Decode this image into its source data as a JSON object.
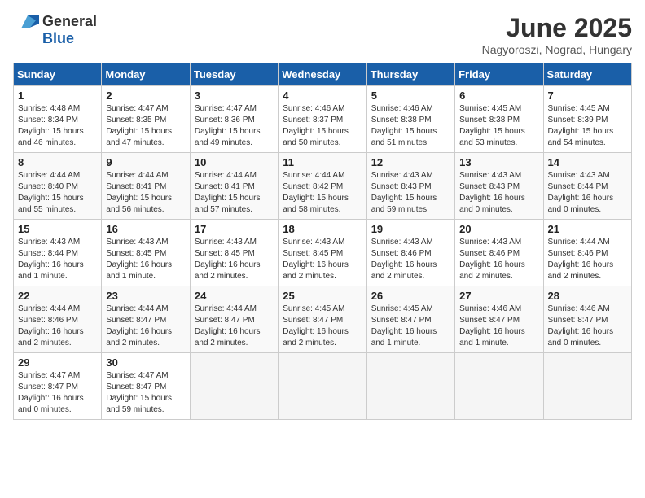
{
  "logo": {
    "general": "General",
    "blue": "Blue"
  },
  "title": "June 2025",
  "location": "Nagyoroszi, Nograd, Hungary",
  "weekdays": [
    "Sunday",
    "Monday",
    "Tuesday",
    "Wednesday",
    "Thursday",
    "Friday",
    "Saturday"
  ],
  "weeks": [
    [
      {
        "day": "1",
        "info": "Sunrise: 4:48 AM\nSunset: 8:34 PM\nDaylight: 15 hours\nand 46 minutes."
      },
      {
        "day": "2",
        "info": "Sunrise: 4:47 AM\nSunset: 8:35 PM\nDaylight: 15 hours\nand 47 minutes."
      },
      {
        "day": "3",
        "info": "Sunrise: 4:47 AM\nSunset: 8:36 PM\nDaylight: 15 hours\nand 49 minutes."
      },
      {
        "day": "4",
        "info": "Sunrise: 4:46 AM\nSunset: 8:37 PM\nDaylight: 15 hours\nand 50 minutes."
      },
      {
        "day": "5",
        "info": "Sunrise: 4:46 AM\nSunset: 8:38 PM\nDaylight: 15 hours\nand 51 minutes."
      },
      {
        "day": "6",
        "info": "Sunrise: 4:45 AM\nSunset: 8:38 PM\nDaylight: 15 hours\nand 53 minutes."
      },
      {
        "day": "7",
        "info": "Sunrise: 4:45 AM\nSunset: 8:39 PM\nDaylight: 15 hours\nand 54 minutes."
      }
    ],
    [
      {
        "day": "8",
        "info": "Sunrise: 4:44 AM\nSunset: 8:40 PM\nDaylight: 15 hours\nand 55 minutes."
      },
      {
        "day": "9",
        "info": "Sunrise: 4:44 AM\nSunset: 8:41 PM\nDaylight: 15 hours\nand 56 minutes."
      },
      {
        "day": "10",
        "info": "Sunrise: 4:44 AM\nSunset: 8:41 PM\nDaylight: 15 hours\nand 57 minutes."
      },
      {
        "day": "11",
        "info": "Sunrise: 4:44 AM\nSunset: 8:42 PM\nDaylight: 15 hours\nand 58 minutes."
      },
      {
        "day": "12",
        "info": "Sunrise: 4:43 AM\nSunset: 8:43 PM\nDaylight: 15 hours\nand 59 minutes."
      },
      {
        "day": "13",
        "info": "Sunrise: 4:43 AM\nSunset: 8:43 PM\nDaylight: 16 hours\nand 0 minutes."
      },
      {
        "day": "14",
        "info": "Sunrise: 4:43 AM\nSunset: 8:44 PM\nDaylight: 16 hours\nand 0 minutes."
      }
    ],
    [
      {
        "day": "15",
        "info": "Sunrise: 4:43 AM\nSunset: 8:44 PM\nDaylight: 16 hours\nand 1 minute."
      },
      {
        "day": "16",
        "info": "Sunrise: 4:43 AM\nSunset: 8:45 PM\nDaylight: 16 hours\nand 1 minute."
      },
      {
        "day": "17",
        "info": "Sunrise: 4:43 AM\nSunset: 8:45 PM\nDaylight: 16 hours\nand 2 minutes."
      },
      {
        "day": "18",
        "info": "Sunrise: 4:43 AM\nSunset: 8:45 PM\nDaylight: 16 hours\nand 2 minutes."
      },
      {
        "day": "19",
        "info": "Sunrise: 4:43 AM\nSunset: 8:46 PM\nDaylight: 16 hours\nand 2 minutes."
      },
      {
        "day": "20",
        "info": "Sunrise: 4:43 AM\nSunset: 8:46 PM\nDaylight: 16 hours\nand 2 minutes."
      },
      {
        "day": "21",
        "info": "Sunrise: 4:44 AM\nSunset: 8:46 PM\nDaylight: 16 hours\nand 2 minutes."
      }
    ],
    [
      {
        "day": "22",
        "info": "Sunrise: 4:44 AM\nSunset: 8:46 PM\nDaylight: 16 hours\nand 2 minutes."
      },
      {
        "day": "23",
        "info": "Sunrise: 4:44 AM\nSunset: 8:47 PM\nDaylight: 16 hours\nand 2 minutes."
      },
      {
        "day": "24",
        "info": "Sunrise: 4:44 AM\nSunset: 8:47 PM\nDaylight: 16 hours\nand 2 minutes."
      },
      {
        "day": "25",
        "info": "Sunrise: 4:45 AM\nSunset: 8:47 PM\nDaylight: 16 hours\nand 2 minutes."
      },
      {
        "day": "26",
        "info": "Sunrise: 4:45 AM\nSunset: 8:47 PM\nDaylight: 16 hours\nand 1 minute."
      },
      {
        "day": "27",
        "info": "Sunrise: 4:46 AM\nSunset: 8:47 PM\nDaylight: 16 hours\nand 1 minute."
      },
      {
        "day": "28",
        "info": "Sunrise: 4:46 AM\nSunset: 8:47 PM\nDaylight: 16 hours\nand 0 minutes."
      }
    ],
    [
      {
        "day": "29",
        "info": "Sunrise: 4:47 AM\nSunset: 8:47 PM\nDaylight: 16 hours\nand 0 minutes."
      },
      {
        "day": "30",
        "info": "Sunrise: 4:47 AM\nSunset: 8:47 PM\nDaylight: 15 hours\nand 59 minutes."
      },
      null,
      null,
      null,
      null,
      null
    ]
  ]
}
